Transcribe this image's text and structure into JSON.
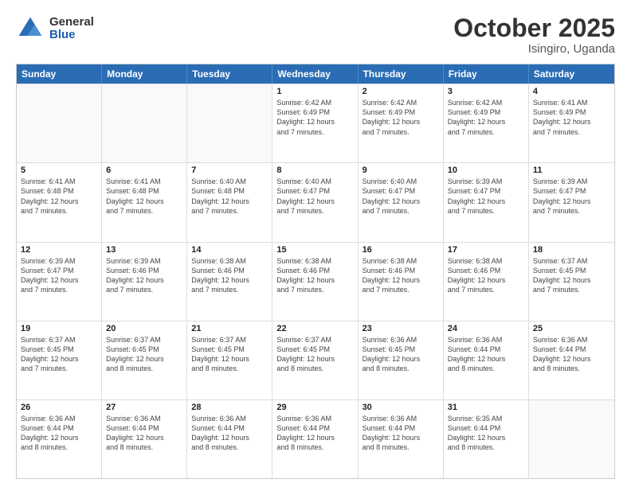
{
  "header": {
    "logo_general": "General",
    "logo_blue": "Blue",
    "month_title": "October 2025",
    "location": "Isingiro, Uganda"
  },
  "calendar": {
    "days": [
      "Sunday",
      "Monday",
      "Tuesday",
      "Wednesday",
      "Thursday",
      "Friday",
      "Saturday"
    ],
    "rows": [
      [
        {
          "day": "",
          "text": ""
        },
        {
          "day": "",
          "text": ""
        },
        {
          "day": "",
          "text": ""
        },
        {
          "day": "1",
          "text": "Sunrise: 6:42 AM\nSunset: 6:49 PM\nDaylight: 12 hours\nand 7 minutes."
        },
        {
          "day": "2",
          "text": "Sunrise: 6:42 AM\nSunset: 6:49 PM\nDaylight: 12 hours\nand 7 minutes."
        },
        {
          "day": "3",
          "text": "Sunrise: 6:42 AM\nSunset: 6:49 PM\nDaylight: 12 hours\nand 7 minutes."
        },
        {
          "day": "4",
          "text": "Sunrise: 6:41 AM\nSunset: 6:49 PM\nDaylight: 12 hours\nand 7 minutes."
        }
      ],
      [
        {
          "day": "5",
          "text": "Sunrise: 6:41 AM\nSunset: 6:48 PM\nDaylight: 12 hours\nand 7 minutes."
        },
        {
          "day": "6",
          "text": "Sunrise: 6:41 AM\nSunset: 6:48 PM\nDaylight: 12 hours\nand 7 minutes."
        },
        {
          "day": "7",
          "text": "Sunrise: 6:40 AM\nSunset: 6:48 PM\nDaylight: 12 hours\nand 7 minutes."
        },
        {
          "day": "8",
          "text": "Sunrise: 6:40 AM\nSunset: 6:47 PM\nDaylight: 12 hours\nand 7 minutes."
        },
        {
          "day": "9",
          "text": "Sunrise: 6:40 AM\nSunset: 6:47 PM\nDaylight: 12 hours\nand 7 minutes."
        },
        {
          "day": "10",
          "text": "Sunrise: 6:39 AM\nSunset: 6:47 PM\nDaylight: 12 hours\nand 7 minutes."
        },
        {
          "day": "11",
          "text": "Sunrise: 6:39 AM\nSunset: 6:47 PM\nDaylight: 12 hours\nand 7 minutes."
        }
      ],
      [
        {
          "day": "12",
          "text": "Sunrise: 6:39 AM\nSunset: 6:47 PM\nDaylight: 12 hours\nand 7 minutes."
        },
        {
          "day": "13",
          "text": "Sunrise: 6:39 AM\nSunset: 6:46 PM\nDaylight: 12 hours\nand 7 minutes."
        },
        {
          "day": "14",
          "text": "Sunrise: 6:38 AM\nSunset: 6:46 PM\nDaylight: 12 hours\nand 7 minutes."
        },
        {
          "day": "15",
          "text": "Sunrise: 6:38 AM\nSunset: 6:46 PM\nDaylight: 12 hours\nand 7 minutes."
        },
        {
          "day": "16",
          "text": "Sunrise: 6:38 AM\nSunset: 6:46 PM\nDaylight: 12 hours\nand 7 minutes."
        },
        {
          "day": "17",
          "text": "Sunrise: 6:38 AM\nSunset: 6:46 PM\nDaylight: 12 hours\nand 7 minutes."
        },
        {
          "day": "18",
          "text": "Sunrise: 6:37 AM\nSunset: 6:45 PM\nDaylight: 12 hours\nand 7 minutes."
        }
      ],
      [
        {
          "day": "19",
          "text": "Sunrise: 6:37 AM\nSunset: 6:45 PM\nDaylight: 12 hours\nand 7 minutes."
        },
        {
          "day": "20",
          "text": "Sunrise: 6:37 AM\nSunset: 6:45 PM\nDaylight: 12 hours\nand 8 minutes."
        },
        {
          "day": "21",
          "text": "Sunrise: 6:37 AM\nSunset: 6:45 PM\nDaylight: 12 hours\nand 8 minutes."
        },
        {
          "day": "22",
          "text": "Sunrise: 6:37 AM\nSunset: 6:45 PM\nDaylight: 12 hours\nand 8 minutes."
        },
        {
          "day": "23",
          "text": "Sunrise: 6:36 AM\nSunset: 6:45 PM\nDaylight: 12 hours\nand 8 minutes."
        },
        {
          "day": "24",
          "text": "Sunrise: 6:36 AM\nSunset: 6:44 PM\nDaylight: 12 hours\nand 8 minutes."
        },
        {
          "day": "25",
          "text": "Sunrise: 6:36 AM\nSunset: 6:44 PM\nDaylight: 12 hours\nand 8 minutes."
        }
      ],
      [
        {
          "day": "26",
          "text": "Sunrise: 6:36 AM\nSunset: 6:44 PM\nDaylight: 12 hours\nand 8 minutes."
        },
        {
          "day": "27",
          "text": "Sunrise: 6:36 AM\nSunset: 6:44 PM\nDaylight: 12 hours\nand 8 minutes."
        },
        {
          "day": "28",
          "text": "Sunrise: 6:36 AM\nSunset: 6:44 PM\nDaylight: 12 hours\nand 8 minutes."
        },
        {
          "day": "29",
          "text": "Sunrise: 6:36 AM\nSunset: 6:44 PM\nDaylight: 12 hours\nand 8 minutes."
        },
        {
          "day": "30",
          "text": "Sunrise: 6:36 AM\nSunset: 6:44 PM\nDaylight: 12 hours\nand 8 minutes."
        },
        {
          "day": "31",
          "text": "Sunrise: 6:35 AM\nSunset: 6:44 PM\nDaylight: 12 hours\nand 8 minutes."
        },
        {
          "day": "",
          "text": ""
        }
      ]
    ]
  }
}
